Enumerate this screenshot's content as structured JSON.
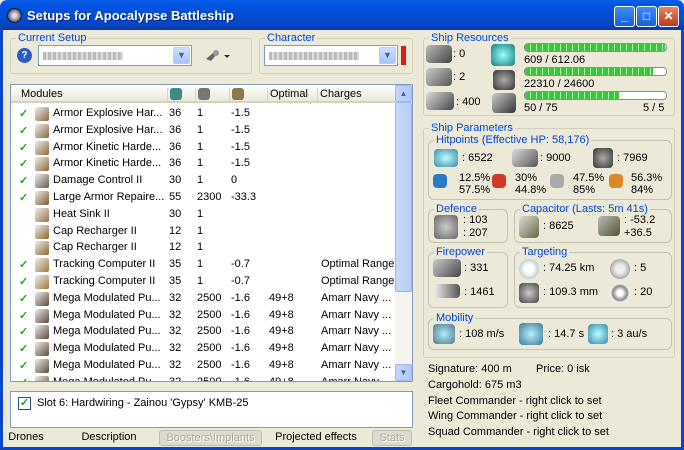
{
  "window": {
    "title": "Setups for Apocalypse Battleship",
    "minimize": "_",
    "maximize": "□",
    "close": "✕"
  },
  "current_setup": {
    "label": "Current Setup",
    "help": "?"
  },
  "character": {
    "label": "Character"
  },
  "modules": {
    "headers": {
      "name": "Modules",
      "optimal": "Optimal",
      "charges": "Charges"
    },
    "rows": [
      {
        "checked": true,
        "name": "Armor Explosive Har...",
        "a": "36",
        "b": "1",
        "c": "-1.5",
        "optimal": "",
        "charges": "",
        "icon": "armor-hardener-icon",
        "color": "#8a6a3a"
      },
      {
        "checked": true,
        "name": "Armor Explosive Har...",
        "a": "36",
        "b": "1",
        "c": "-1.5",
        "optimal": "",
        "charges": "",
        "icon": "armor-hardener-icon",
        "color": "#8a6a3a"
      },
      {
        "checked": true,
        "name": "Armor Kinetic Harde...",
        "a": "36",
        "b": "1",
        "c": "-1.5",
        "optimal": "",
        "charges": "",
        "icon": "armor-hardener-icon",
        "color": "#8a6a3a"
      },
      {
        "checked": true,
        "name": "Armor Kinetic Harde...",
        "a": "36",
        "b": "1",
        "c": "-1.5",
        "optimal": "",
        "charges": "",
        "icon": "armor-hardener-icon",
        "color": "#8a6a3a"
      },
      {
        "checked": true,
        "name": "Damage Control II",
        "a": "30",
        "b": "1",
        "c": "0",
        "optimal": "",
        "charges": "",
        "icon": "damage-control-icon",
        "color": "#6b5a48"
      },
      {
        "checked": true,
        "name": "Large Armor Repaire...",
        "a": "55",
        "b": "2300",
        "c": "-33.3",
        "optimal": "",
        "charges": "",
        "icon": "armor-repairer-icon",
        "color": "#7a5a2a"
      },
      {
        "checked": false,
        "name": "Heat Sink II",
        "a": "30",
        "b": "1",
        "c": "",
        "optimal": "",
        "charges": "",
        "icon": "heat-sink-icon",
        "color": "#9a7048"
      },
      {
        "checked": false,
        "name": "Cap Recharger II",
        "a": "12",
        "b": "1",
        "c": "",
        "optimal": "",
        "charges": "",
        "icon": "cap-recharger-icon",
        "color": "#8a6a2a"
      },
      {
        "checked": false,
        "name": "Cap Recharger II",
        "a": "12",
        "b": "1",
        "c": "",
        "optimal": "",
        "charges": "",
        "icon": "cap-recharger-icon",
        "color": "#8a6a2a"
      },
      {
        "checked": true,
        "name": "Tracking Computer II",
        "a": "35",
        "b": "1",
        "c": "-0.7",
        "optimal": "",
        "charges": "Optimal Range",
        "icon": "tracking-computer-icon",
        "color": "#a07a3a"
      },
      {
        "checked": true,
        "name": "Tracking Computer II",
        "a": "35",
        "b": "1",
        "c": "-0.7",
        "optimal": "",
        "charges": "Optimal Range",
        "icon": "tracking-computer-icon",
        "color": "#a07a3a"
      },
      {
        "checked": true,
        "name": "Mega Modulated Pu...",
        "a": "32",
        "b": "2500",
        "c": "-1.6",
        "optimal": "49+8",
        "charges": "Amarr Navy ...",
        "icon": "pulse-laser-icon",
        "color": "#5a4a3a"
      },
      {
        "checked": true,
        "name": "Mega Modulated Pu...",
        "a": "32",
        "b": "2500",
        "c": "-1.6",
        "optimal": "49+8",
        "charges": "Amarr Navy ...",
        "icon": "pulse-laser-icon",
        "color": "#5a4a3a"
      },
      {
        "checked": true,
        "name": "Mega Modulated Pu...",
        "a": "32",
        "b": "2500",
        "c": "-1.6",
        "optimal": "49+8",
        "charges": "Amarr Navy ...",
        "icon": "pulse-laser-icon",
        "color": "#5a4a3a"
      },
      {
        "checked": true,
        "name": "Mega Modulated Pu...",
        "a": "32",
        "b": "2500",
        "c": "-1.6",
        "optimal": "49+8",
        "charges": "Amarr Navy ...",
        "icon": "pulse-laser-icon",
        "color": "#5a4a3a"
      },
      {
        "checked": true,
        "name": "Mega Modulated Pu...",
        "a": "32",
        "b": "2500",
        "c": "-1.6",
        "optimal": "49+8",
        "charges": "Amarr Navy ...",
        "icon": "pulse-laser-icon",
        "color": "#5a4a3a"
      },
      {
        "checked": true,
        "name": "Mega Modulated Pu...",
        "a": "32",
        "b": "2500",
        "c": "-1.6",
        "optimal": "49+8",
        "charges": "Amarr Navy ...",
        "icon": "pulse-laser-icon",
        "color": "#5a4a3a"
      },
      {
        "checked": true,
        "name": "Mega Modulated Pu...",
        "a": "32",
        "b": "2500",
        "c": "-1.6",
        "optimal": "49+8",
        "charges": "Amarr Navy ...",
        "icon": "pulse-laser-icon",
        "color": "#5a4a3a"
      }
    ]
  },
  "slot_info": {
    "checked": true,
    "text": "Slot 6: Hardwiring - Zainou 'Gypsy' KMB-25"
  },
  "tabs": [
    {
      "label": "Drones",
      "enabled": true
    },
    {
      "label": "Description",
      "enabled": true
    },
    {
      "label": "Boosters\\Implants",
      "enabled": false
    },
    {
      "label": "Projected effects",
      "enabled": true
    },
    {
      "label": "Stats",
      "enabled": false
    }
  ],
  "ship_resources": {
    "label": "Ship Resources",
    "turrets": ": 0",
    "launchers": ": 2",
    "drone_bandwidth": ": 400",
    "cpu": "609 / 612.06",
    "cpu_fraction": 0.99,
    "powergrid": "22310 / 24600",
    "powergrid_fraction": 0.91,
    "calibration": "50 / 75",
    "calibration_fraction": 0.67,
    "rigs": "5 / 5"
  },
  "ship_parameters": {
    "label": "Ship Parameters",
    "hitpoints": {
      "label": "Hitpoints (Effective HP: 58,176)",
      "shield": ": 6522",
      "armor": ": 9000",
      "hull": ": 7969",
      "shield_res_em": "12.5%",
      "shield_res_th": "57.5%",
      "armor_res_em": "30%",
      "armor_res_th": "44.8%",
      "kin_res_a": "47.5%",
      "kin_res_b": "85%",
      "exp_res_a": "56.3%",
      "exp_res_b": "84%"
    },
    "defence": {
      "label": "Defence",
      "v1": ": 103",
      "v2": ": 207"
    },
    "capacitor": {
      "label": "Capacitor (Lasts: 5m 41s)",
      "capacity": ": 8625",
      "v1": ": -53.2",
      "v2": "+36.5"
    },
    "firepower": {
      "label": "Firepower",
      "turret_dps": ": 331",
      "volley": ": 1461"
    },
    "targeting": {
      "label": "Targeting",
      "range": ": 74.25 km",
      "max_targets": ": 5",
      "scan_res": ": 109.3 mm",
      "sensor_strength": ": 20"
    },
    "mobility": {
      "label": "Mobility",
      "speed": ": 108 m/s",
      "align": ": 14.7 s",
      "warp": ": 3 au/s"
    }
  },
  "info": {
    "signature": "Signature: 400 m",
    "price": "Price: 0 isk",
    "cargohold": "Cargohold: 675 m3",
    "fleet": "Fleet Commander - right click to set",
    "wing": "Wing Commander - right click to set",
    "squad": "Squad Commander - right click to set"
  }
}
